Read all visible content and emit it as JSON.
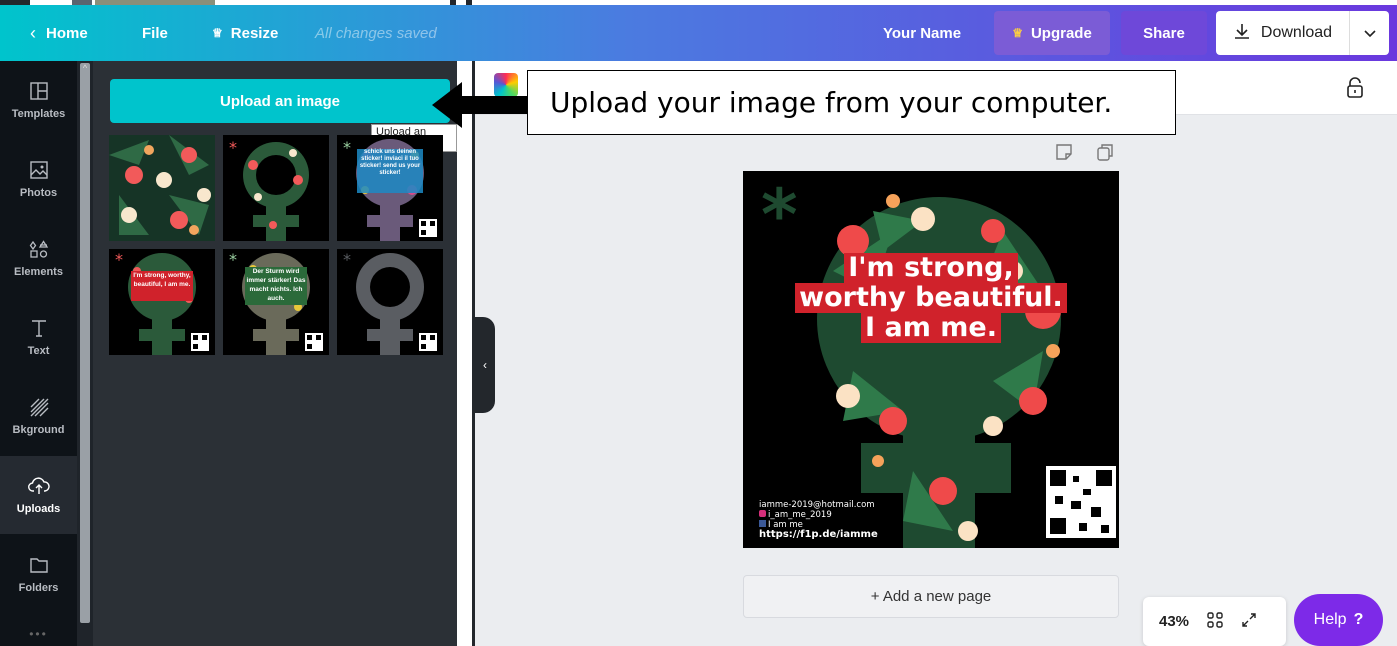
{
  "topbar": {
    "home": "Home",
    "file": "File",
    "resize": "Resize",
    "saved_status": "All changes saved",
    "user_name": "Your Name",
    "upgrade": "Upgrade",
    "share": "Share",
    "download": "Download"
  },
  "sidebar": {
    "items": [
      {
        "label": "Templates",
        "icon": "templates-icon"
      },
      {
        "label": "Photos",
        "icon": "photos-icon"
      },
      {
        "label": "Elements",
        "icon": "elements-icon"
      },
      {
        "label": "Text",
        "icon": "text-icon"
      },
      {
        "label": "Bkground",
        "icon": "background-icon"
      },
      {
        "label": "Uploads",
        "icon": "uploads-icon",
        "active": true
      },
      {
        "label": "Folders",
        "icon": "folders-icon"
      }
    ]
  },
  "panel": {
    "upload_button": "Upload an image",
    "tooltip": "Upload an image",
    "thumbnails": [
      {
        "type": "floral",
        "text": ""
      },
      {
        "type": "venus-floral-ring",
        "text": ""
      },
      {
        "type": "venus-stickers",
        "text": "schick uns deinen sticker! inviaci il tuo sticker! send us your sticker!"
      },
      {
        "type": "venus-text",
        "text": "I'm strong, worthy, beautiful, I am me."
      },
      {
        "type": "venus-text",
        "text": "Der Sturm wird immer stärker! Das macht nichts. Ich auch."
      },
      {
        "type": "venus-grey",
        "text": ""
      }
    ]
  },
  "callout": {
    "text": "Upload your image from your computer."
  },
  "design": {
    "line1": "I'm strong,",
    "line2": "worthy beautiful.",
    "line3": "I am me.",
    "email": "iamme-2019@hotmail.com",
    "instagram": "i_am_me_2019",
    "facebook": "I am me",
    "url": "https://f1p.de/iamme"
  },
  "canvas": {
    "add_page": "+ Add a new page",
    "zoom": "43%",
    "help": "Help",
    "help_mark": "?"
  },
  "colors": {
    "accent": "#00c4cc",
    "purple": "#7d2ae8",
    "upgrade_bg": "#7b5cd6",
    "share_bg": "#6e48d9",
    "red_text_bg": "#d0222b"
  }
}
